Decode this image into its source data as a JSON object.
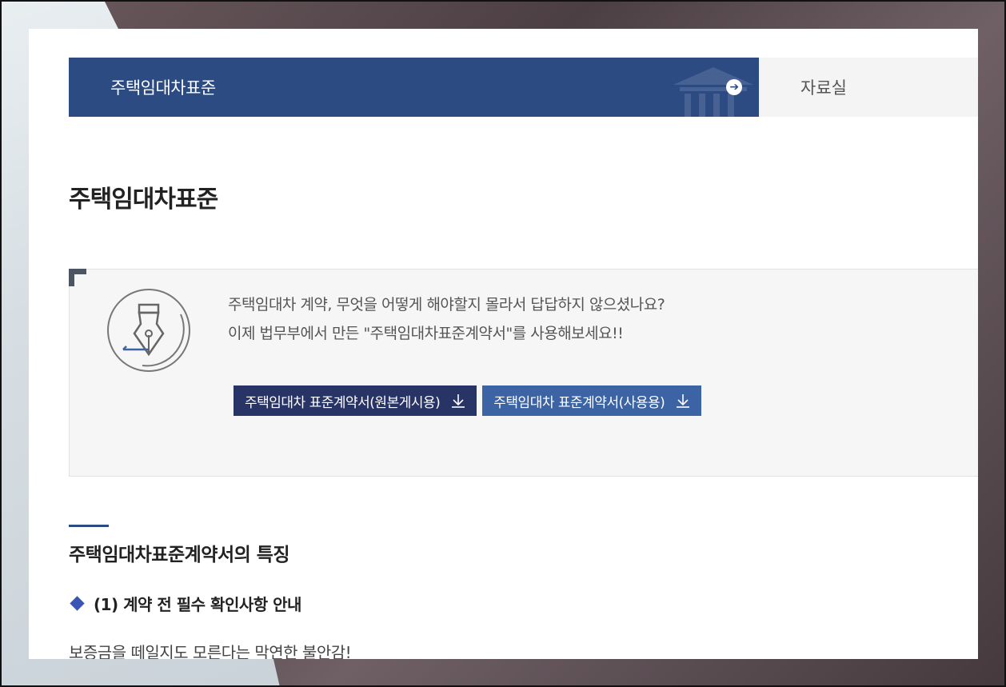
{
  "nav": {
    "active_tab": "주택임대차표준",
    "inactive_tab": "자료실",
    "active_colour": "#2b4b82"
  },
  "page_title": "주택임대차표준",
  "intro": {
    "line1": "주택임대차 계약, 무엇을 어떻게 해야할지 몰라서 답답하지 않으셨나요?",
    "line2": "이제 법무부에서 만든 \"주택임대차표준계약서\"를 사용해보세요!!",
    "icon": "fountain-pen-icon"
  },
  "downloads": [
    {
      "label": "주택임대차 표준계약서(원본게시용)",
      "icon": "download-icon",
      "colour": "#293466"
    },
    {
      "label": "주택임대차 표준계약서(사용용)",
      "icon": "download-icon",
      "colour": "#3c63a3"
    }
  ],
  "section": {
    "title": "주택임대차표준계약서의 특징",
    "item_heading": "(1) 계약 전 필수 확인사항 안내",
    "item_text": "보증금을 떼일지도 모른다는 막연한 불안감!"
  }
}
